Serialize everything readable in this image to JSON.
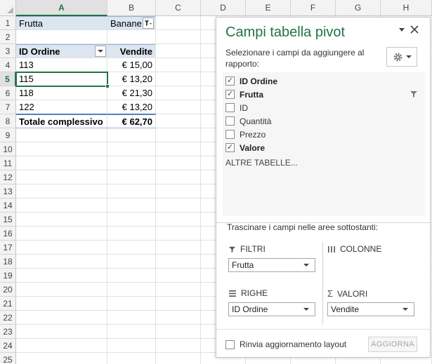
{
  "sheet": {
    "columns": [
      "A",
      "B",
      "C",
      "D",
      "E",
      "F",
      "G",
      "H"
    ],
    "rows": [
      "1",
      "2",
      "3",
      "4",
      "5",
      "6",
      "7",
      "8",
      "9",
      "10",
      "11",
      "12",
      "13",
      "14",
      "15",
      "16",
      "17",
      "18",
      "19",
      "20",
      "21",
      "22",
      "23",
      "24",
      "25"
    ],
    "cells": {
      "a1": "Frutta",
      "b1": "Banane",
      "a3": "ID Ordine",
      "b3": "Vendite",
      "a4": "113",
      "b4": "€ 15,00",
      "a5": "115",
      "b5": "€ 13,20",
      "a6": "118",
      "b6": "€ 21,30",
      "a7": "122",
      "b7": "€ 13,20",
      "a8": "Totale complessivo",
      "b8": "€ 62,70"
    },
    "active_column": "A",
    "active_row": "5",
    "accent_color": "#217346"
  },
  "pane": {
    "title": "Campi tabella pivot",
    "description": "Selezionare i campi da aggiungere al rapporto:",
    "fields": [
      {
        "label": "ID Ordine",
        "checked": true,
        "bold": true
      },
      {
        "label": "Frutta",
        "checked": true,
        "bold": true,
        "filtered": true
      },
      {
        "label": "ID",
        "checked": false,
        "bold": false
      },
      {
        "label": "Quantità",
        "checked": false,
        "bold": false
      },
      {
        "label": "Prezzo",
        "checked": false,
        "bold": false
      },
      {
        "label": "Valore",
        "checked": true,
        "bold": true
      }
    ],
    "more_tables": "ALTRE TABELLE...",
    "drag_description": "Trascinare i campi nelle aree sottostanti:",
    "areas": {
      "filters": {
        "title": "FILTRI",
        "value": "Frutta"
      },
      "columns": {
        "title": "COLONNE"
      },
      "rows": {
        "title": "RIGHE",
        "value": "ID Ordine"
      },
      "values": {
        "title": "VALORI",
        "value": "Vendite"
      }
    },
    "defer_label": "Rinvia aggiornamento layout",
    "update_label": "AGGIORNA",
    "check_mark": "✓",
    "sigma_glyph": "Σ"
  }
}
